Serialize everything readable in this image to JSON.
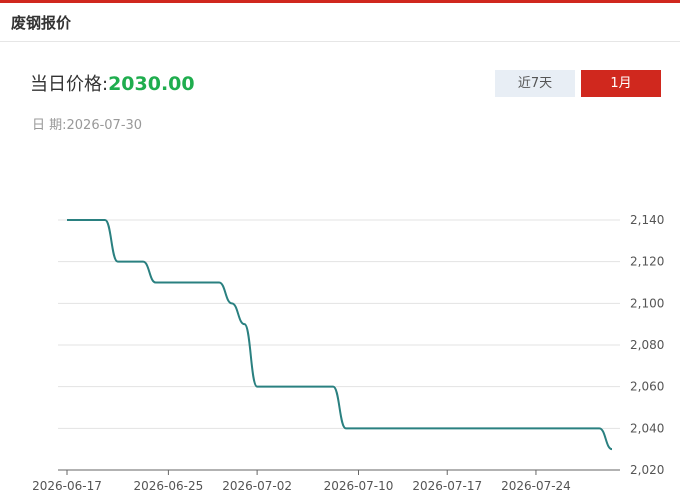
{
  "header": {
    "title": "废钢报价"
  },
  "price": {
    "label": "当日价格:",
    "value": "2030.00"
  },
  "date": {
    "label": "日 期:",
    "value": "2026-07-30"
  },
  "tabs": [
    {
      "label": "近7天",
      "active": false
    },
    {
      "label": "1月",
      "active": true
    }
  ],
  "colors": {
    "accent": "#d0281e",
    "price": "#1fad4e",
    "line": "#2a8080"
  },
  "chart_data": {
    "type": "line",
    "title": "",
    "xlabel": "",
    "ylabel": "",
    "ylim": [
      2020,
      2140
    ],
    "yticks": [
      2020,
      2040,
      2060,
      2080,
      2100,
      2120,
      2140
    ],
    "ytick_labels": [
      "2,020",
      "2,040",
      "2,060",
      "2,080",
      "2,100",
      "2,120",
      "2,140"
    ],
    "xtick_labels": [
      "2026-06-17",
      "2026-06-25",
      "2026-07-02",
      "2026-07-10",
      "2026-07-17",
      "2026-07-24"
    ],
    "y_axis_position": "right",
    "grid": "horizontal",
    "series": [
      {
        "x": [
          "2026-06-17",
          "2026-06-18",
          "2026-06-19",
          "2026-06-20",
          "2026-06-21",
          "2026-06-22",
          "2026-06-23",
          "2026-06-24",
          "2026-06-25",
          "2026-06-26",
          "2026-06-27",
          "2026-06-28",
          "2026-06-29",
          "2026-06-30",
          "2026-07-01",
          "2026-07-02",
          "2026-07-03",
          "2026-07-04",
          "2026-07-05",
          "2026-07-06",
          "2026-07-07",
          "2026-07-08",
          "2026-07-09",
          "2026-07-10",
          "2026-07-11",
          "2026-07-12",
          "2026-07-13",
          "2026-07-14",
          "2026-07-15",
          "2026-07-16",
          "2026-07-17",
          "2026-07-18",
          "2026-07-19",
          "2026-07-20",
          "2026-07-21",
          "2026-07-22",
          "2026-07-23",
          "2026-07-24",
          "2026-07-25",
          "2026-07-26",
          "2026-07-27",
          "2026-07-28",
          "2026-07-29",
          "2026-07-30"
        ],
        "values": [
          2140,
          2140,
          2140,
          2140,
          2120,
          2120,
          2120,
          2110,
          2110,
          2110,
          2110,
          2110,
          2110,
          2100,
          2090,
          2060,
          2060,
          2060,
          2060,
          2060,
          2060,
          2060,
          2040,
          2040,
          2040,
          2040,
          2040,
          2040,
          2040,
          2040,
          2040,
          2040,
          2040,
          2040,
          2040,
          2040,
          2040,
          2040,
          2040,
          2040,
          2040,
          2040,
          2040,
          2030
        ]
      }
    ]
  }
}
